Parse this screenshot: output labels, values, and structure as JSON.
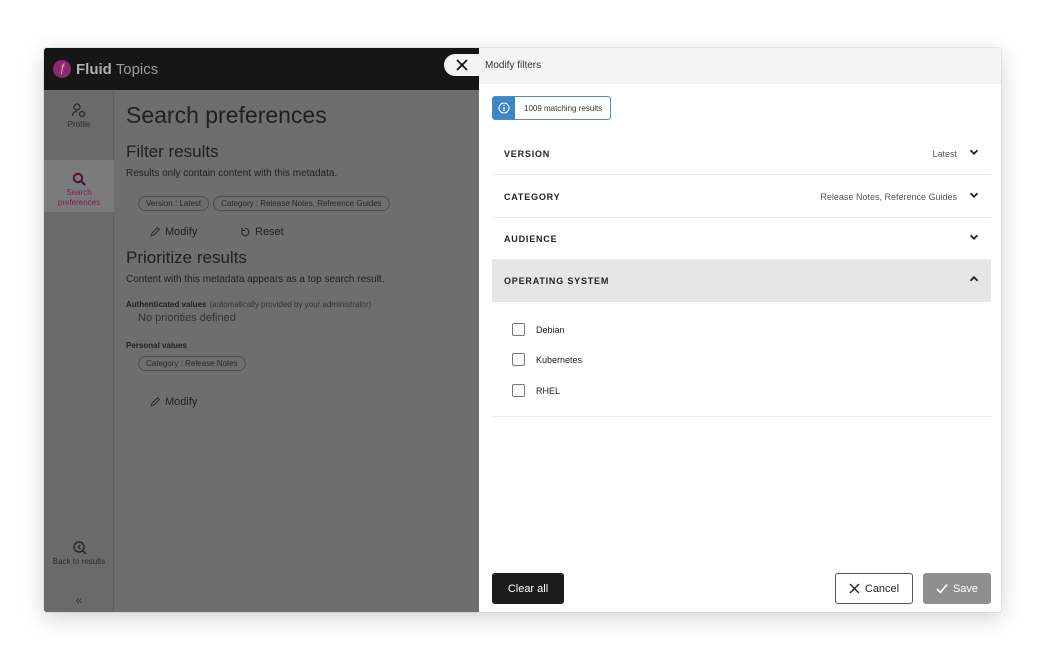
{
  "app": {
    "brand_bold": "Fluid",
    "brand_rest": " Topics"
  },
  "rail": {
    "profile": "Profile",
    "search_line1": "Search",
    "search_line2": "preferences",
    "back": "Back to results",
    "collapse": "«"
  },
  "prefs": {
    "title": "Search preferences",
    "filter_heading": "Filter results",
    "filter_desc": "Results only contain content with this metadata.",
    "filter_chips": [
      "Version : Latest",
      "Category : Release Notes, Reference Guides"
    ],
    "modify": "Modify",
    "reset": "Reset",
    "prioritize_heading": "Prioritize results",
    "prioritize_desc": "Content with this metadata appears as a top search result.",
    "auth_label": "Authenticated values",
    "auth_note": "(automatically provided by your administrator)",
    "no_priorities": "No priorities defined",
    "personal_label": "Personal values",
    "personal_chip": "Category : Release Notes",
    "modify2": "Modify"
  },
  "modal": {
    "title": "Modify filters",
    "matching": "1009 matching results",
    "facets": [
      {
        "name": "VERSION",
        "value": "Latest",
        "expanded": false
      },
      {
        "name": "CATEGORY",
        "value": "Release Notes, Reference Guides",
        "expanded": false
      },
      {
        "name": "AUDIENCE",
        "value": "",
        "expanded": false
      },
      {
        "name": "OPERATING SYSTEM",
        "value": "",
        "expanded": true
      }
    ],
    "os_options": [
      {
        "label": "Debian",
        "checked": false
      },
      {
        "label": "Kubernetes",
        "checked": false
      },
      {
        "label": "RHEL",
        "checked": false
      }
    ],
    "clear_all": "Clear all",
    "cancel": "Cancel",
    "save": "Save"
  },
  "colors": {
    "accent": "#3c85c6",
    "brand": "#8b2a6a",
    "overlay": "#6e6e6e"
  }
}
